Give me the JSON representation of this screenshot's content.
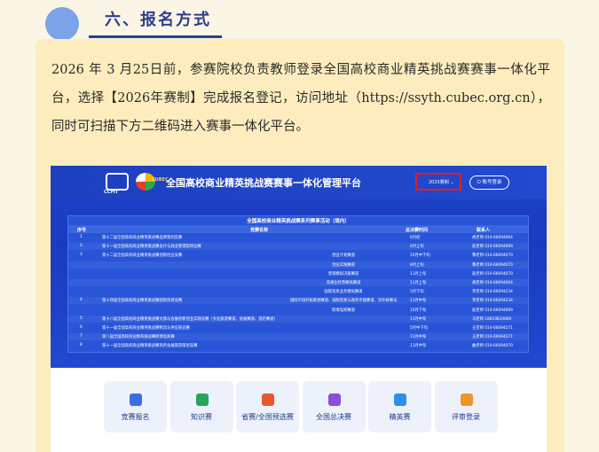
{
  "section": {
    "title": "六、报名方式",
    "paragraph": "2026 年 3 月25日前，参赛院校负责教师登录全国高校商业精英挑战赛赛事一体化平台，选择【2026年赛制】完成报名登记，访问地址（https://ssyth.cubec.org.cn），同时可扫描下方二维码进入赛事一体化平台。"
  },
  "platform": {
    "logo_text": "CCPIT",
    "logo2_text": "CUBEC",
    "title": "全国高校商业精英挑战赛赛事一体化管理平台",
    "season_select": "2025赛制 ⌄",
    "login_button": "⏻ 账号登录"
  },
  "table": {
    "caption": "全国高校商业精英挑战赛系列赛事活动（境内）",
    "columns": [
      "序号",
      "竞赛名称",
      "总决赛时间",
      "联系人"
    ],
    "rows": [
      {
        "no": "1",
        "name": "第十二届全国高校商业精英挑战赛品牌策划竞赛",
        "sub": "",
        "time": "6月初",
        "contact": "胡老师 010-66094064"
      },
      {
        "no": "2",
        "name": "第十一届全国高校商业精英挑战赛会计与商业管理案例竞赛",
        "sub": "",
        "time": "6月上旬",
        "contact": "赵老师 010-66094069"
      },
      {
        "no": "3",
        "name": "第十二届全国高校商业精英挑战赛创新创业竞赛",
        "sub": "创业计划赛道",
        "time": "10月中下旬",
        "contact": "黎老师 010-66094070"
      },
      {
        "no": "",
        "name": "",
        "sub": "创业实践赛道",
        "time": "8月上旬",
        "contact": "黎老师 010-66094070"
      },
      {
        "no": "",
        "name": "",
        "sub": "营销模拟决策赛道",
        "time": "11月上旬",
        "contact": "赵老师 010-66094070"
      },
      {
        "no": "",
        "name": "",
        "sub": "流通业经营模拟赛道",
        "time": "11月上旬",
        "contact": "胡老师 010-66094064"
      },
      {
        "no": "",
        "name": "",
        "sub": "国际贸易业务模拟赛道",
        "time": "5月下旬",
        "contact": "李老师 010-66094234"
      },
      {
        "no": "4",
        "name": "第十四届全国高校商业精英挑战赛国际贸易竞赛",
        "sub": "国际市场开拓策划赛道、国际贸易与商务专能赛道、涉外商事法律服务赛道以及技术性贸易措施(TBT)赛道",
        "time": "11月中旬",
        "contact": "李老师 010-66094234"
      },
      {
        "no": "",
        "name": "",
        "sub": "跨境电商赛道",
        "time": "10月下旬",
        "contact": "赵老师 010-66094069"
      },
      {
        "no": "5",
        "name": "第十八届全国高校商业精英挑战赛文旅与会展创新创业实践竞赛（文化旅游赛道、会展赛道、酒店赛道）",
        "sub": "",
        "time": "11月中旬",
        "contact": "马老师 18810834866"
      },
      {
        "no": "6",
        "name": "第十一届全国高校商业精英挑战赛物流与供应链竞赛",
        "sub": "",
        "time": "5月中下旬",
        "contact": "王老师 010-66094271"
      },
      {
        "no": "7",
        "name": "第八届全国高校商业精英挑战赛跨境电商赛",
        "sub": "",
        "time": "11月中旬",
        "contact": "王老师 010-66094271"
      },
      {
        "no": "8",
        "name": "第十一届全国高校商业精英挑战赛商务会展旅游策划竞赛",
        "sub": "",
        "time": "11月中旬",
        "contact": "曲老师 010-66094070"
      }
    ]
  },
  "tiles": [
    {
      "label": "竞赛报名",
      "icon": "register-icon",
      "color": "#3b6fe0"
    },
    {
      "label": "知识赛",
      "icon": "book-icon",
      "color": "#27a55b"
    },
    {
      "label": "省赛/全国预选赛",
      "icon": "trophy-icon",
      "color": "#e55a2b"
    },
    {
      "label": "全国总决赛",
      "icon": "medal-icon",
      "color": "#8a4fd8"
    },
    {
      "label": "精英赛",
      "icon": "star-icon",
      "color": "#2f8fe8"
    },
    {
      "label": "评审登录",
      "icon": "judge-icon",
      "color": "#f0942a"
    }
  ]
}
